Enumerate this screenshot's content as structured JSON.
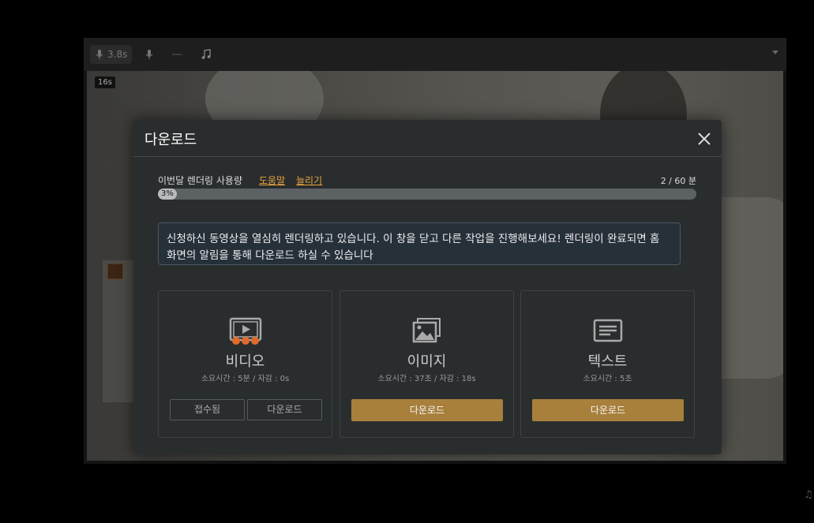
{
  "editor": {
    "toolbar": {
      "mic_time": "3.8s"
    },
    "timestamp_badge": "16s"
  },
  "modal": {
    "title": "다운로드",
    "usage": {
      "label": "이번달 렌더링 사용량",
      "help_link": "도움말",
      "increase_link": "늘리기",
      "count": "2 / 60 분",
      "percent_text": "3%",
      "percent": 3
    },
    "notice": "신청하신 동영상을 열심히 렌더링하고 있습니다. 이 창을 닫고 다른 작업을 진행해보세요! 렌더링이 완료되면 홈 화면의 알림을 통해 다운로드 하실 수 있습니다",
    "cards": [
      {
        "title": "비디오",
        "meta": "소요시간 : 5분 / 자감 : 0s",
        "icon": "video-play-icon",
        "status_button": "접수됨",
        "download_button": "다운로드"
      },
      {
        "title": "이미지",
        "meta": "소요시간 : 37초 / 자감 : 18s",
        "icon": "image-gallery-icon",
        "download_button": "다운로드"
      },
      {
        "title": "텍스트",
        "meta": "소요시간 : 5초",
        "icon": "text-document-icon",
        "download_button": "다운로드"
      }
    ]
  },
  "colors": {
    "accent": "#e8a43b",
    "gold_button": "#a8803c",
    "modal_bg": "#2a2d2e",
    "notice_bg": "#263039"
  }
}
